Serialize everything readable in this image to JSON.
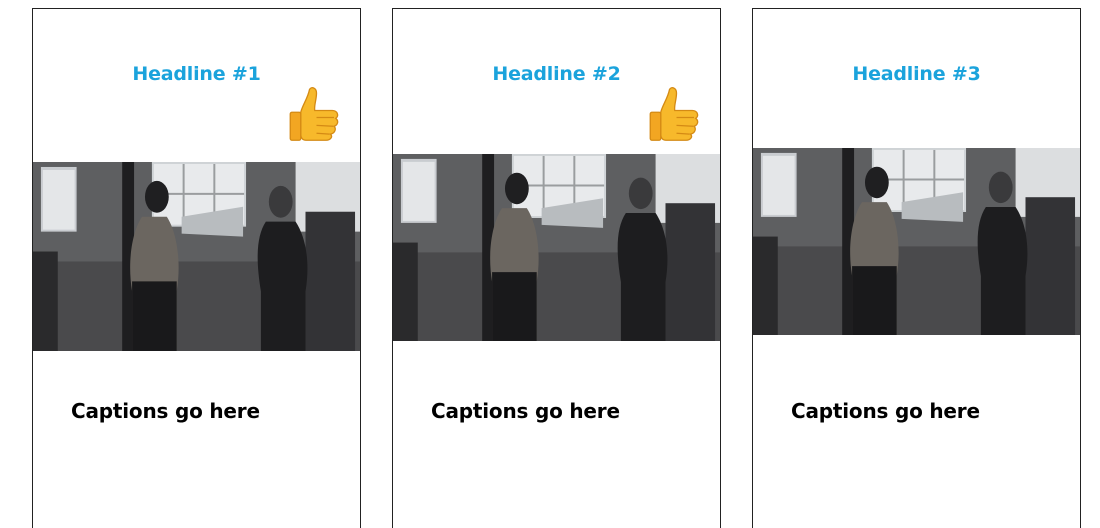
{
  "accent_color": "#1ba3dc",
  "panels": [
    {
      "headline": "Headline #1",
      "caption": "Captions go here",
      "has_thumb": true
    },
    {
      "headline": "Headline #2",
      "caption": "Captions go here",
      "has_thumb": true
    },
    {
      "headline": "Headline #3",
      "caption": "Captions go here",
      "has_thumb": false
    }
  ],
  "icons": {
    "thumb": "thumbs-up-icon"
  }
}
